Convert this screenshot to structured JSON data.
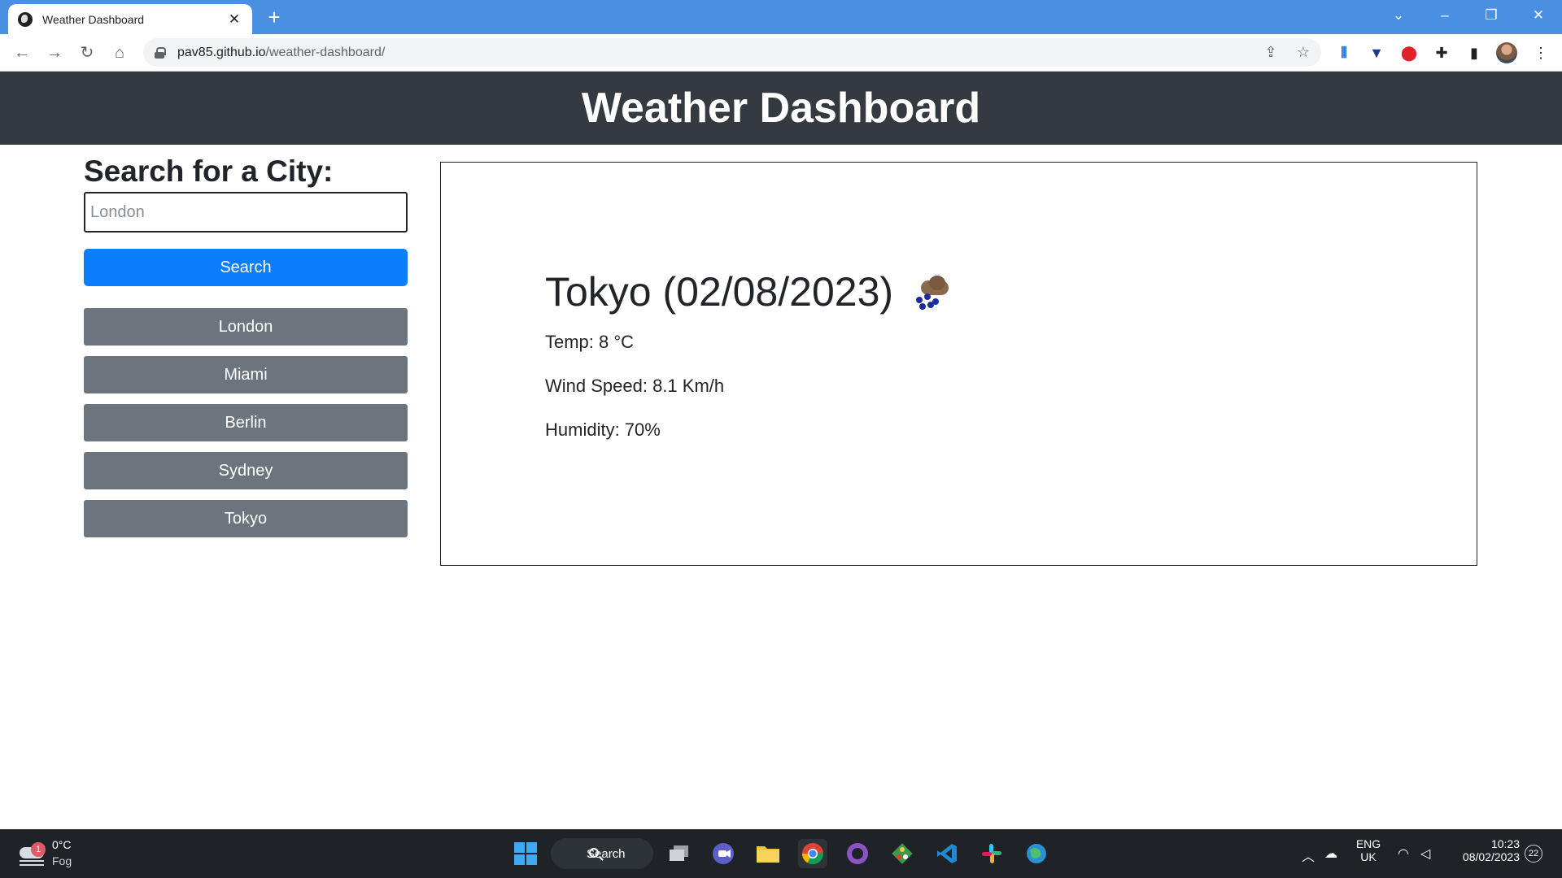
{
  "browser": {
    "tab_title": "Weather Dashboard",
    "tab_close": "✕",
    "new_tab": "+",
    "url_host": "pav85.github.io",
    "url_path": "/weather-dashboard/"
  },
  "page": {
    "title": "Weather Dashboard",
    "search_heading": "Search for a City:",
    "search_placeholder": "London",
    "search_button": "Search",
    "history": [
      "London",
      "Miami",
      "Berlin",
      "Sydney",
      "Tokyo"
    ]
  },
  "current": {
    "title": "Tokyo (02/08/2023)",
    "temp": "Temp: 8 °C",
    "wind": "Wind Speed: 8.1 Km/h",
    "humidity": "Humidity: 70%",
    "icon": "rain-cloud-icon"
  },
  "taskbar": {
    "weather_temp": "0°C",
    "weather_cond": "Fog",
    "weather_badge": "1",
    "search_label": "Search",
    "lang_top": "ENG",
    "lang_bottom": "UK",
    "time": "10:23",
    "date": "08/02/2023",
    "notifications": "22"
  },
  "colors": {
    "header_bg": "#343a40",
    "primary_button": "#0d7efb",
    "secondary_button": "#6c757d",
    "tab_strip": "#4a90e2"
  }
}
